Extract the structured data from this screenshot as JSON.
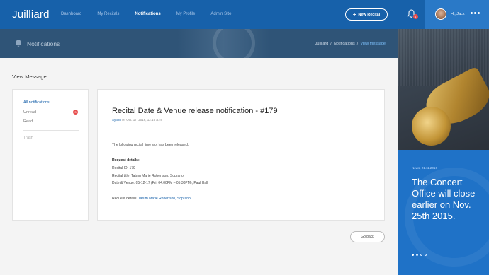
{
  "app": {
    "brand": "Juilliard"
  },
  "nav": {
    "items": [
      "Dashboard",
      "My Recitals",
      "Notifications",
      "My Profile",
      "Admin Site"
    ],
    "active_index": 2
  },
  "toolbar": {
    "new_recital_label": "New Recital"
  },
  "notifications": {
    "count": "1"
  },
  "user": {
    "greeting": "Hi, Jack"
  },
  "header": {
    "title": "Notifications",
    "breadcrumb": [
      "Juilliard",
      "/",
      "Notifications",
      "/",
      "View message"
    ]
  },
  "page": {
    "title": "View Message"
  },
  "sidebar": {
    "items": [
      {
        "label": "All notifications"
      },
      {
        "label": "Unread",
        "badge": "3"
      },
      {
        "label": "Read"
      },
      {
        "label": "Trash"
      }
    ]
  },
  "message": {
    "title": "Recital Date & Venue release notification - #179",
    "sender": "Sytem",
    "date": "on Oct. 17, 2016, 12:15 a.m.",
    "intro": "The following recital time slot has been released.",
    "details_heading": "Request details:",
    "recital_id": "Recital ID: 179",
    "recital_title": "Recital title: Tatum Marie Robertson, Soprano",
    "date_venue": "Date & Venue: 05-12-17 (Fri, 04:00PM – 05:30PM), Paul Hall",
    "details_prefix": "Request details:",
    "details_link": "Tatum Marie Robertson, Soprano"
  },
  "actions": {
    "go_back_label": "Go back"
  },
  "promo": {
    "date": "News, 21.11.2016",
    "text": "The Concert Office will close earlier on Nov. 25th 2015.",
    "dots": 4,
    "active_dot": 0
  },
  "colors": {
    "nav_bg": "#1761aa",
    "user_bg": "#2a79c7",
    "header_bg": "#2f5477",
    "promo_blue": "#1f72c7",
    "badge_red": "#e74c4c",
    "link": "#1761aa"
  },
  "icons": {
    "bell": "bell-icon",
    "header": "bell-icon",
    "plus": "plus-icon",
    "more": "more-dots-icon"
  }
}
